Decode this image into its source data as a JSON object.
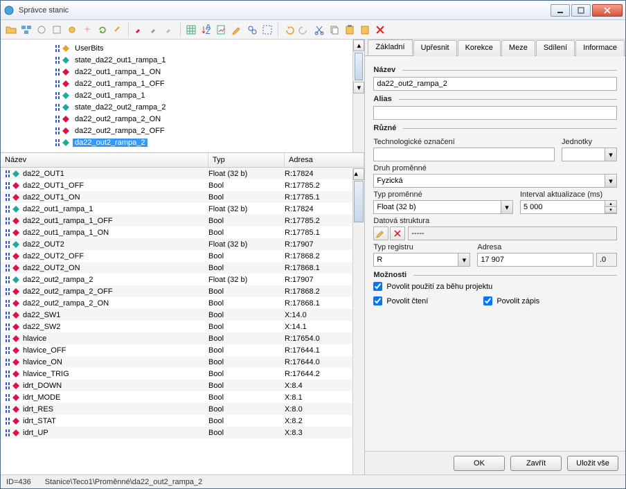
{
  "window": {
    "title": "Správce stanic"
  },
  "tree": {
    "items": [
      {
        "name": "UserBits",
        "p": "blue",
        "d": "orange"
      },
      {
        "name": "state_da22_out1_rampa_1",
        "p": "blue",
        "d": "teal"
      },
      {
        "name": "da22_out1_rampa_1_ON",
        "p": "blue",
        "d": "red"
      },
      {
        "name": "da22_out1_rampa_1_OFF",
        "p": "blue",
        "d": "red"
      },
      {
        "name": "da22_out1_rampa_1",
        "p": "blue",
        "d": "teal"
      },
      {
        "name": "state_da22_out2_rampa_2",
        "p": "blue",
        "d": "teal"
      },
      {
        "name": "da22_out2_rampa_2_ON",
        "p": "blue",
        "d": "red"
      },
      {
        "name": "da22_out2_rampa_2_OFF",
        "p": "blue",
        "d": "red"
      },
      {
        "name": "da22_out2_rampa_2",
        "p": "blue",
        "d": "teal",
        "sel": true
      }
    ]
  },
  "grid": {
    "headers": {
      "name": "Název",
      "type": "Typ",
      "addr": "Adresa"
    },
    "rows": [
      {
        "name": "da22_OUT1",
        "type": "Float (32 b)",
        "addr": "R:17824",
        "d": "teal"
      },
      {
        "name": "da22_OUT1_OFF",
        "type": "Bool",
        "addr": "R:17785.2",
        "d": "red"
      },
      {
        "name": "da22_OUT1_ON",
        "type": "Bool",
        "addr": "R:17785.1",
        "d": "red"
      },
      {
        "name": "da22_out1_rampa_1",
        "type": "Float (32 b)",
        "addr": "R:17824",
        "d": "teal"
      },
      {
        "name": "da22_out1_rampa_1_OFF",
        "type": "Bool",
        "addr": "R:17785.2",
        "d": "red"
      },
      {
        "name": "da22_out1_rampa_1_ON",
        "type": "Bool",
        "addr": "R:17785.1",
        "d": "red"
      },
      {
        "name": "da22_OUT2",
        "type": "Float (32 b)",
        "addr": "R:17907",
        "d": "teal"
      },
      {
        "name": "da22_OUT2_OFF",
        "type": "Bool",
        "addr": "R:17868.2",
        "d": "red"
      },
      {
        "name": "da22_OUT2_ON",
        "type": "Bool",
        "addr": "R:17868.1",
        "d": "red"
      },
      {
        "name": "da22_out2_rampa_2",
        "type": "Float (32 b)",
        "addr": "R:17907",
        "d": "teal"
      },
      {
        "name": "da22_out2_rampa_2_OFF",
        "type": "Bool",
        "addr": "R:17868.2",
        "d": "red"
      },
      {
        "name": "da22_out2_rampa_2_ON",
        "type": "Bool",
        "addr": "R:17868.1",
        "d": "red"
      },
      {
        "name": "da22_SW1",
        "type": "Bool",
        "addr": "X:14.0",
        "d": "red"
      },
      {
        "name": "da22_SW2",
        "type": "Bool",
        "addr": "X:14.1",
        "d": "red"
      },
      {
        "name": "hlavice",
        "type": "Bool",
        "addr": "R:17654.0",
        "d": "red"
      },
      {
        "name": "hlavice_OFF",
        "type": "Bool",
        "addr": "R:17644.1",
        "d": "red"
      },
      {
        "name": "hlavice_ON",
        "type": "Bool",
        "addr": "R:17644.0",
        "d": "red"
      },
      {
        "name": "hlavice_TRIG",
        "type": "Bool",
        "addr": "R:17644.2",
        "d": "red"
      },
      {
        "name": "idrt_DOWN",
        "type": "Bool",
        "addr": "X:8.4",
        "d": "red"
      },
      {
        "name": "idrt_MODE",
        "type": "Bool",
        "addr": "X:8.1",
        "d": "red"
      },
      {
        "name": "idrt_RES",
        "type": "Bool",
        "addr": "X:8.0",
        "d": "red"
      },
      {
        "name": "idrt_STAT",
        "type": "Bool",
        "addr": "X:8.2",
        "d": "red"
      },
      {
        "name": "idrt_UP",
        "type": "Bool",
        "addr": "X:8.3",
        "d": "red"
      }
    ]
  },
  "tabs": [
    "Základní",
    "Upřesnit",
    "Korekce",
    "Meze",
    "Sdílení",
    "Informace"
  ],
  "form": {
    "name_label": "Název",
    "name_value": "da22_out2_rampa_2",
    "alias_label": "Alias",
    "alias_value": "",
    "misc_label": "Různé",
    "tech_label": "Technologické označení",
    "units_label": "Jednotky",
    "vartype_label": "Druh proměnné",
    "vartype_value": "Fyzická",
    "type_label": "Typ proměnné",
    "type_value": "Float (32 b)",
    "interval_label": "Interval aktualizace (ms)",
    "interval_value": "5 000",
    "datastruct_label": "Datová struktura",
    "datastruct_value": "-----",
    "regtype_label": "Typ registru",
    "regtype_value": "R",
    "addr_label": "Adresa",
    "addr_value": "17 907",
    "addr_bit": ".0",
    "options_label": "Možnosti",
    "opt1": "Povolit použití za běhu projektu",
    "opt2": "Povolit čtení",
    "opt3": "Povolit zápis"
  },
  "footer": {
    "ok": "OK",
    "close": "Zavřít",
    "saveall": "Uložit vše"
  },
  "status": {
    "id": "ID=436",
    "path": "Stanice\\Teco1\\Proměnné\\da22_out2_rampa_2"
  }
}
